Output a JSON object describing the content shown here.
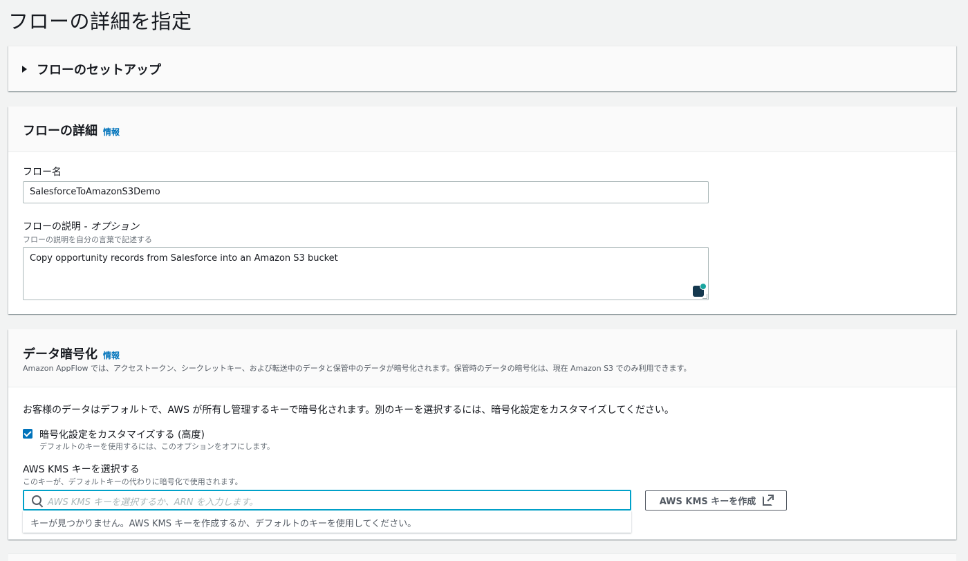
{
  "page": {
    "title": "フローの詳細を指定"
  },
  "setup": {
    "title": "フローのセットアップ"
  },
  "details": {
    "title": "フローの詳細",
    "info": "情報",
    "name_label": "フロー名",
    "name_value": "SalesforceToAmazonS3Demo",
    "desc_label": "フローの説明 - ",
    "desc_label_optional": "オプション",
    "desc_hint": "フローの説明を自分の言葉で記述する",
    "desc_value": "Copy opportunity records from Salesforce into an Amazon S3 bucket"
  },
  "encryption": {
    "title": "データ暗号化",
    "info": "情報",
    "description": "Amazon AppFlow では、アクセストークン、シークレットキー、および転送中のデータと保管中のデータが暗号化されます。保管時のデータの暗号化は、現在 Amazon S3 でのみ利用できます。",
    "note": "お客様のデータはデフォルトで、AWS が所有し管理するキーで暗号化されます。別のキーを選択するには、暗号化設定をカスタマイズしてください。",
    "customize_label": "暗号化設定をカスタマイズする (高度)",
    "customize_desc": "デフォルトのキーを使用するには、このオプションをオフにします。",
    "customize_checked": true,
    "kms_label": "AWS KMS キーを選択する",
    "kms_desc": "このキーが、デフォルトキーの代わりに暗号化で使用されます。",
    "kms_placeholder": "AWS KMS キーを選択するか、ARN を入力します。",
    "kms_empty": "キーが見つかりません。AWS KMS キーを作成するか、デフォルトのキーを使用してください。",
    "create_button": "AWS KMS キーを作成"
  },
  "colors": {
    "accent": "#0073bb",
    "focus": "#00a1c9",
    "background": "#f2f3f3"
  }
}
